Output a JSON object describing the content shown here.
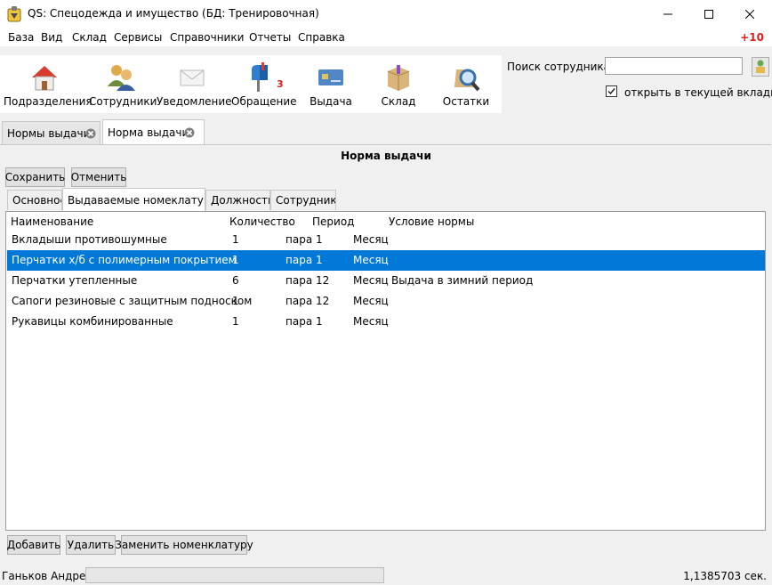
{
  "window": {
    "title": "QS: Спецодежда и имущество (БД: Тренировочная)"
  },
  "menu": {
    "items": [
      "База",
      "Вид",
      "Склад",
      "Сервисы",
      "Справочники",
      "Отчеты",
      "Справка"
    ],
    "notification_count": "+10"
  },
  "toolbar": {
    "items": [
      {
        "label": "Подразделения",
        "icon": "house-icon"
      },
      {
        "label": "Сотрудники",
        "icon": "people-icon"
      },
      {
        "label": "Уведомление",
        "icon": "envelope-icon"
      },
      {
        "label": "Обращение",
        "icon": "mailbox-icon",
        "badge": "3"
      },
      {
        "label": "Выдача",
        "icon": "card-icon"
      },
      {
        "label": "Склад",
        "icon": "box-icon"
      },
      {
        "label": "Остатки",
        "icon": "magnifier-icon"
      }
    ]
  },
  "search": {
    "label": "Поиск сотрудника:",
    "value": "",
    "open_in_current_tab_label": "открыть в текущей вкладке",
    "open_in_current_tab_checked": true
  },
  "doc_tabs": [
    {
      "label": "Нормы выдачи",
      "active": false
    },
    {
      "label": "Норма выдачи",
      "active": true
    }
  ],
  "page": {
    "heading": "Норма выдачи",
    "save_label": "Сохранить",
    "cancel_label": "Отменить"
  },
  "inner_tabs": [
    "Основное",
    "Выдаваемые номеклатуры",
    "Должности",
    "Сотрудники"
  ],
  "table": {
    "columns": [
      "Наименование",
      "Количество",
      "Период",
      "Условие нормы"
    ],
    "rows": [
      {
        "name": "Вкладыши противошумные",
        "qty": "1",
        "unit": "пара",
        "period": "1",
        "period_unit": "Месяц",
        "condition": "",
        "selected": false
      },
      {
        "name": "Перчатки х/б с полимерным покрытием",
        "qty": "1",
        "unit": "пара",
        "period": "1",
        "period_unit": "Месяц",
        "condition": "",
        "selected": true
      },
      {
        "name": "Перчатки  утепленные",
        "qty": "6",
        "unit": "пара",
        "period": "12",
        "period_unit": "Месяц",
        "condition": "Выдача в зимний период",
        "selected": false
      },
      {
        "name": "Сапоги резиновые с защитным подноском",
        "qty": "1",
        "unit": "пара",
        "period": "12",
        "period_unit": "Месяц",
        "condition": "",
        "selected": false
      },
      {
        "name": "Рукавицы комбинированные",
        "qty": "1",
        "unit": "пара",
        "period": "1",
        "period_unit": "Месяц",
        "condition": "",
        "selected": false
      }
    ]
  },
  "actions": {
    "add_label": "Добавить",
    "delete_label": "Удалить",
    "replace_label": "Заменить номенклатуру"
  },
  "status": {
    "user": "Ганьков Андрей",
    "time": "1,1385703 сек."
  },
  "colors": {
    "selection": "#0078d7",
    "badge": "#e21b1b"
  }
}
